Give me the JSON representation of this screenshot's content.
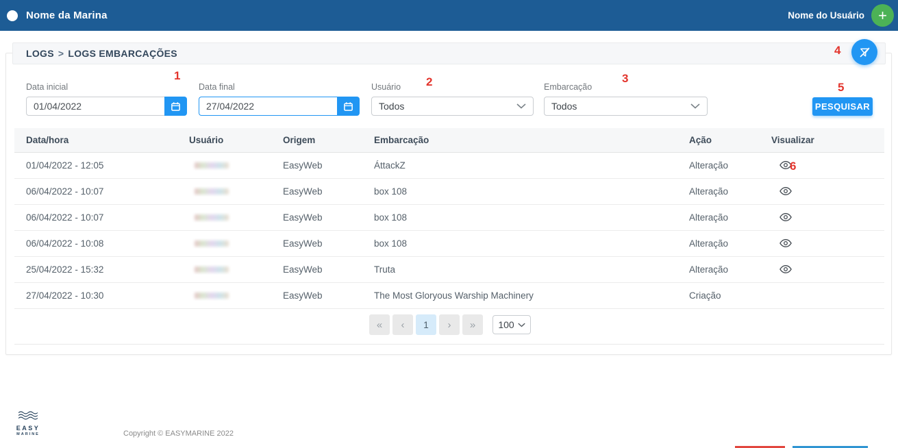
{
  "header": {
    "marina_name": "Nome da Marina",
    "user_name": "Nome do Usuário"
  },
  "breadcrumb": {
    "section": "LOGS",
    "separator": ">",
    "page": "LOGS EMBARCAÇÕES"
  },
  "filters": {
    "start_date": {
      "label": "Data inicial",
      "value": "01/04/2022"
    },
    "end_date": {
      "label": "Data final",
      "value": "27/04/2022"
    },
    "user": {
      "label": "Usuário",
      "value": "Todos"
    },
    "vessel": {
      "label": "Embarcação",
      "value": "Todos"
    },
    "search_button": "PESQUISAR"
  },
  "annotations": {
    "n1": "1",
    "n2": "2",
    "n3": "3",
    "n4": "4",
    "n5": "5",
    "n6": "6"
  },
  "table": {
    "columns": {
      "datetime": "Data/hora",
      "user": "Usuário",
      "origin": "Origem",
      "vessel": "Embarcação",
      "action": "Ação",
      "view": "Visualizar"
    },
    "user_redacted": true,
    "rows": [
      {
        "datetime": "01/04/2022 - 12:05",
        "origin": "EasyWeb",
        "vessel": "ÁttackZ",
        "action": "Alteração"
      },
      {
        "datetime": "06/04/2022 - 10:07",
        "origin": "EasyWeb",
        "vessel": "box 108",
        "action": "Alteração"
      },
      {
        "datetime": "06/04/2022 - 10:07",
        "origin": "EasyWeb",
        "vessel": "box 108",
        "action": "Alteração"
      },
      {
        "datetime": "06/04/2022 - 10:08",
        "origin": "EasyWeb",
        "vessel": "box 108",
        "action": "Alteração"
      },
      {
        "datetime": "25/04/2022 - 15:32",
        "origin": "EasyWeb",
        "vessel": "Truta",
        "action": "Alteração"
      },
      {
        "datetime": "27/04/2022 - 10:30",
        "origin": "EasyWeb",
        "vessel": "The Most Gloryous Warship Machinery",
        "action": "Criação"
      }
    ]
  },
  "pagination": {
    "first": "«",
    "prev": "‹",
    "current_page": "1",
    "next": "›",
    "last": "»",
    "page_size": "100"
  },
  "footer": {
    "logo_top": "EASY",
    "logo_bottom": "MARINE",
    "copyright": "Copyright © EASYMARINE 2022"
  },
  "colors": {
    "header_bar": "#1d5c95",
    "accent_blue": "#2196f3",
    "annotation_red": "#e3342c",
    "add_button_green": "#4cb256",
    "bottom_bar_red": "#e2473e",
    "bottom_bar_blue": "#3095d2"
  }
}
